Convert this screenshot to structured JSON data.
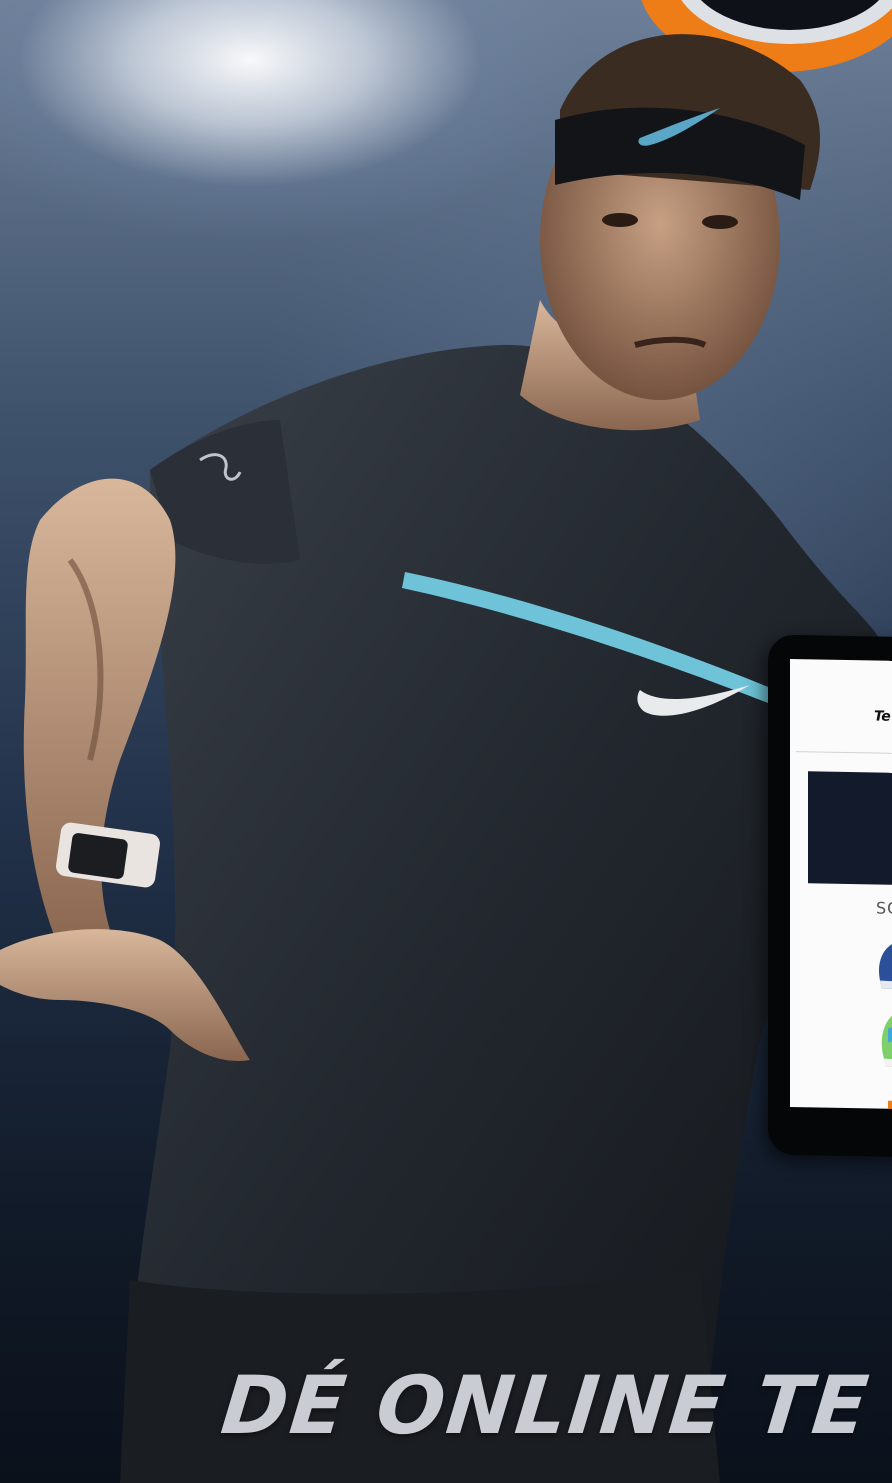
{
  "ad": {
    "headline": "DÉ ONLINE TE",
    "accent_color": "#ef7d17"
  },
  "tablet": {
    "logo_text": "Te",
    "heading": "SC"
  },
  "icons": [
    "nike-swoosh-icon",
    "rafa-logo-icon",
    "orange-ring-logo-icon"
  ]
}
